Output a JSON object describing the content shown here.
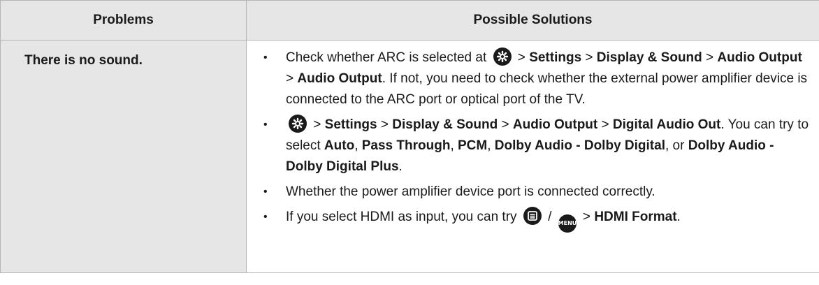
{
  "headers": {
    "problems": "Problems",
    "solutions": "Possible Solutions"
  },
  "problem": "There is no sound.",
  "bullet": "•",
  "items": [
    {
      "t1": "Check whether ARC is selected at",
      "t2": " > ",
      "b1": "Settings",
      "t3": " > ",
      "b2": "Display & Sound",
      "t4": " > ",
      "b3": "Audio Output",
      "t5": "  > ",
      "b4": "Audio Output",
      "t6": ". If not, you need to check whether the external power amplifier device is connected to the ARC port or optical port of the TV."
    },
    {
      "t1": " > ",
      "b1": "Settings",
      "t2": " > ",
      "b2": "Display & Sound",
      "t3": " > ",
      "b3": "Audio Output",
      "t4": " > ",
      "b4": "Digital Audio Out",
      "t5": ". You can try to select ",
      "b5": "Auto",
      "t6": ", ",
      "b6": "Pass Through",
      "t7": ", ",
      "b7": "PCM",
      "t8": ", ",
      "b8": "Dolby Audio - Dolby Digital",
      "t9": ", or ",
      "b9": "Dolby Audio - Dolby Digital Plus",
      "t10": "."
    },
    {
      "t1": "Whether the power amplifier device port is connected correctly."
    },
    {
      "t1": "If you select HDMI as input, you can try",
      "t2": " / ",
      "t3": " > ",
      "b1": "HDMI Format",
      "t4": "."
    }
  ],
  "icons": {
    "settings": "settings-gear-icon",
    "list": "list-icon",
    "menu": "menu-button-icon",
    "menu_text": "MENU"
  }
}
